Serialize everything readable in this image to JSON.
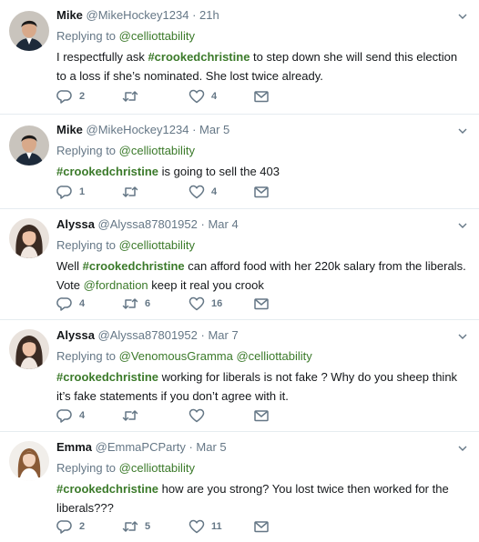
{
  "tweets": [
    {
      "name": "Mike",
      "handle": "@MikeHockey1234",
      "dot": "·",
      "time": "21h",
      "reply_prefix": "Replying to ",
      "reply_to": "@celliottability",
      "text_parts": [
        {
          "kind": "plain",
          "text": "I respectfully ask "
        },
        {
          "kind": "hashtag",
          "text": "#crookedchristine"
        },
        {
          "kind": "plain",
          "text": " to step down she will send this election to a loss if she’s nominated. She lost twice already."
        }
      ],
      "replies": "2",
      "retweets": "",
      "likes": "4"
    },
    {
      "name": "Mike",
      "handle": "@MikeHockey1234",
      "dot": "·",
      "time": "Mar 5",
      "reply_prefix": "Replying to ",
      "reply_to": "@celliottability",
      "text_parts": [
        {
          "kind": "hashtag",
          "text": "#crookedchristine"
        },
        {
          "kind": "plain",
          "text": " is going to sell the 403"
        }
      ],
      "replies": "1",
      "retweets": "",
      "likes": "4"
    },
    {
      "name": "Alyssa",
      "handle": "@Alyssa87801952",
      "dot": "·",
      "time": "Mar 4",
      "reply_prefix": "Replying to ",
      "reply_to": "@celliottability",
      "text_parts": [
        {
          "kind": "plain",
          "text": "Well "
        },
        {
          "kind": "hashtag",
          "text": "#crookedchristine"
        },
        {
          "kind": "plain",
          "text": " can afford food with her 220k salary from the liberals. Vote "
        },
        {
          "kind": "mention",
          "text": "@fordnation"
        },
        {
          "kind": "plain",
          "text": " keep it real you crook"
        }
      ],
      "replies": "4",
      "retweets": "6",
      "likes": "16"
    },
    {
      "name": "Alyssa",
      "handle": "@Alyssa87801952",
      "dot": "·",
      "time": "Mar 7",
      "reply_prefix": "Replying to ",
      "reply_to": "@VenomousGramma @celliottability",
      "text_parts": [
        {
          "kind": "hashtag",
          "text": "#crookedchristine"
        },
        {
          "kind": "plain",
          "text": " working for liberals is not fake ? Why do you sheep think it’s fake statements if you don’t agree with it."
        }
      ],
      "replies": "4",
      "retweets": "",
      "likes": ""
    },
    {
      "name": "Emma",
      "handle": "@EmmaPCParty",
      "dot": "·",
      "time": "Mar 5",
      "reply_prefix": "Replying to ",
      "reply_to": "@celliottability",
      "text_parts": [
        {
          "kind": "hashtag",
          "text": "#crookedchristine"
        },
        {
          "kind": "plain",
          "text": " how are you strong? You lost twice then worked for the liberals???"
        }
      ],
      "replies": "2",
      "retweets": "5",
      "likes": "11"
    }
  ],
  "icons": {
    "reply": "reply-icon",
    "retweet": "retweet-icon",
    "like": "heart-icon",
    "dm": "envelope-icon",
    "caret": "chevron-down-icon"
  },
  "colors": {
    "link": "#3b7a2a",
    "muted": "#657786",
    "divider": "#e6ecf0"
  }
}
